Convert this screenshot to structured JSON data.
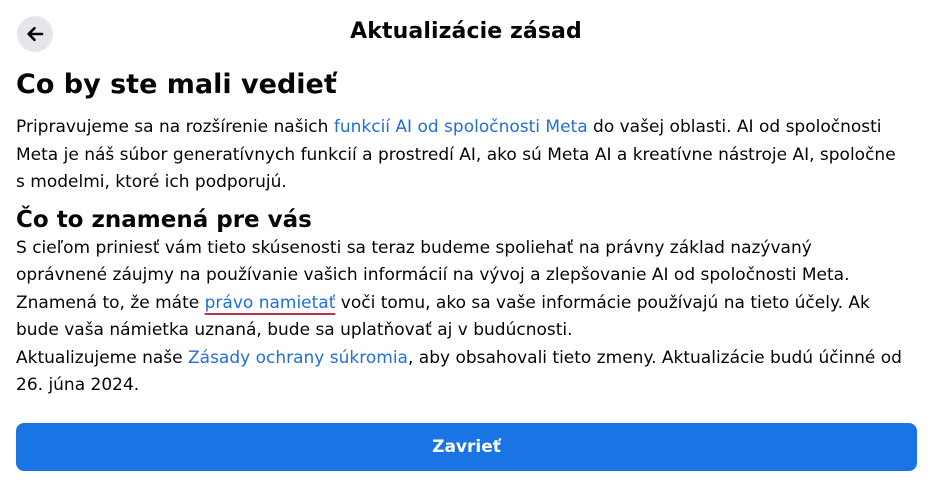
{
  "header": {
    "title": "Aktualizácie zásad",
    "back_icon": "arrow-left-icon"
  },
  "section1": {
    "heading": "Co by ste mali vedieť",
    "text_before_link": "Pripravujeme sa na rozšírenie našich ",
    "link": "funkcií AI od spoločnosti Meta",
    "text_after_link": " do vašej oblasti. AI od spoločnosti Meta je náš súbor generatívnych funkcií a prostredí AI, ako sú Meta AI a kreatívne nástroje AI, spoločne s modelmi, ktoré ich podporujú."
  },
  "section2": {
    "heading": "Čo to znamená pre vás",
    "para1_before_link": "S cieľom priniesť vám tieto skúsenosti sa teraz budeme spoliehať na právny základ nazývaný oprávnené záujmy na používanie vašich informácií na vývoj a zlepšovanie AI od spoločnosti Meta. Znamená to, že máte ",
    "para1_link": "právo namietať",
    "para1_after_link": " voči tomu, ako sa vaše informácie používajú na tieto účely. Ak bude vaša námietka uznaná, bude sa uplatňovať aj v budúcnosti.",
    "para2_before_link": "Aktualizujeme naše ",
    "para2_link": "Zásady ochrany súkromia",
    "para2_after_link": ", aby obsahovali tieto zmeny. Aktualizácie budú účinné od 26. júna 2024."
  },
  "footer": {
    "close_label": "Zavrieť"
  },
  "colors": {
    "accent": "#1b74e4",
    "link": "#216fdb",
    "link_underline": "#c0304a"
  }
}
